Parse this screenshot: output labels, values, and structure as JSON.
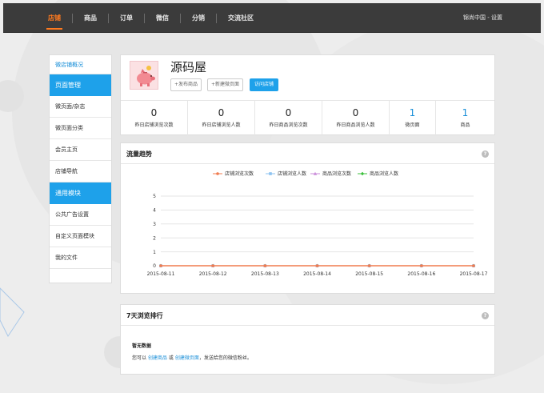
{
  "nav": {
    "items": [
      {
        "label": "店铺",
        "active": true
      },
      {
        "label": "商品",
        "active": false
      },
      {
        "label": "订单",
        "active": false
      },
      {
        "label": "微信",
        "active": false
      },
      {
        "label": "分销",
        "active": false
      },
      {
        "label": "交流社区",
        "active": false
      }
    ],
    "user": "锦尚中国 - 设置"
  },
  "sidebar": {
    "items": [
      {
        "label": "微店铺概况",
        "kind": "head-link"
      },
      {
        "label": "页面管理",
        "kind": "section"
      },
      {
        "label": "微页面/杂志",
        "kind": "item"
      },
      {
        "label": "微页面分类",
        "kind": "item"
      },
      {
        "label": "会员主页",
        "kind": "item"
      },
      {
        "label": "店铺导航",
        "kind": "item"
      },
      {
        "label": "通用模块",
        "kind": "section"
      },
      {
        "label": "公共广告设置",
        "kind": "item"
      },
      {
        "label": "自定义页面模块",
        "kind": "item"
      },
      {
        "label": "我的文件",
        "kind": "item"
      }
    ]
  },
  "shop": {
    "name": "源码屋",
    "buttons": {
      "publish": "+发布商品",
      "new_page": "+新建微页面",
      "visit": "访问店铺"
    },
    "stats": [
      {
        "value": "0",
        "label": "昨日店铺浏览次数",
        "highlight": false
      },
      {
        "value": "0",
        "label": "昨日店铺浏览人数",
        "highlight": false
      },
      {
        "value": "0",
        "label": "昨日商品浏览次数",
        "highlight": false
      },
      {
        "value": "0",
        "label": "昨日商品浏览人数",
        "highlight": false
      },
      {
        "value": "1",
        "label": "微页面",
        "highlight": true
      },
      {
        "value": "1",
        "label": "商品",
        "highlight": true
      }
    ]
  },
  "trend": {
    "title": "流量趋势",
    "help": "?"
  },
  "chart_data": {
    "type": "line",
    "x": [
      "2015-08-11",
      "2015-08-12",
      "2015-08-13",
      "2015-08-14",
      "2015-08-15",
      "2015-08-16",
      "2015-08-17"
    ],
    "series": [
      {
        "name": "店铺浏览次数",
        "values": [
          0,
          0,
          0,
          0,
          0,
          0,
          0
        ],
        "color": "#f07b4f",
        "marker": "circle"
      },
      {
        "name": "店铺浏览人数",
        "values": [
          0,
          0,
          0,
          0,
          0,
          0,
          0
        ],
        "color": "#8ec3f0",
        "marker": "square"
      },
      {
        "name": "商品浏览次数",
        "values": [
          0,
          0,
          0,
          0,
          0,
          0,
          0
        ],
        "color": "#c98bd9",
        "marker": "triangle"
      },
      {
        "name": "商品浏览人数",
        "values": [
          0,
          0,
          0,
          0,
          0,
          0,
          0
        ],
        "color": "#3bbf3b",
        "marker": "diamond"
      }
    ],
    "yticks": [
      "0",
      "1",
      "2",
      "3",
      "4",
      "5"
    ],
    "ylim": [
      0,
      5
    ],
    "grid": true,
    "legend": "top-center"
  },
  "rank": {
    "title": "7天浏览排行",
    "help": "?",
    "empty_title": "暂无数据",
    "empty_prefix": "您可以",
    "link_goods": "创建商品",
    "or": "或",
    "link_page": "创建微页面",
    "empty_suffix": "，发送给您的微信粉丝。"
  }
}
